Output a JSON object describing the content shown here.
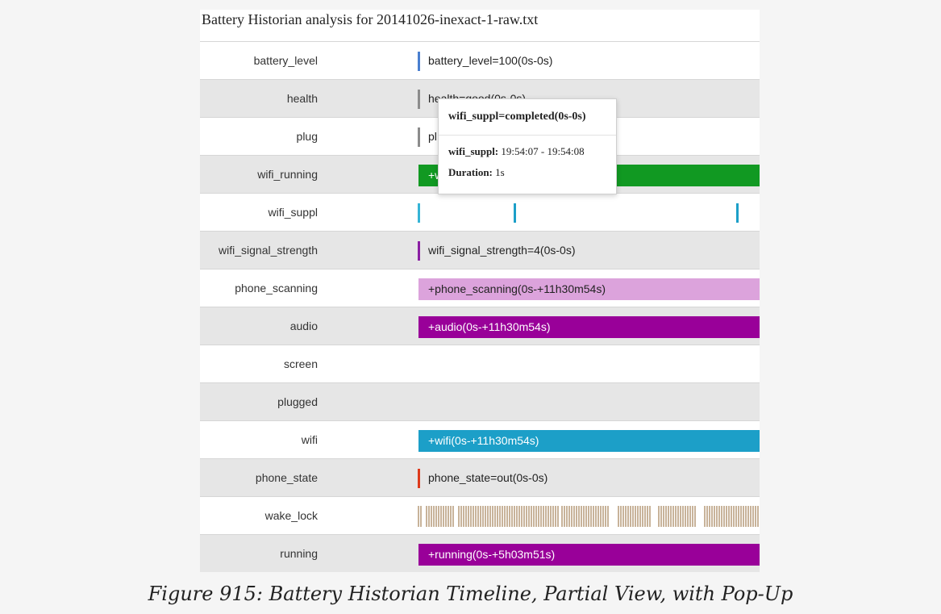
{
  "title": "Battery Historian analysis for 20141026-inexact-1-raw.txt",
  "rows": [
    {
      "label": "battery_level",
      "text": "battery_level=100(0s-0s)",
      "color": "#4a7fd0"
    },
    {
      "label": "health",
      "text": "health=good(0s-0s)",
      "color": "#8c8c8c"
    },
    {
      "label": "plug",
      "text": "pl",
      "color": "#8c8c8c"
    },
    {
      "label": "wifi_running",
      "text": "+w",
      "color": "#119922"
    },
    {
      "label": "wifi_suppl",
      "text": "",
      "color": "#36b4d6"
    },
    {
      "label": "wifi_signal_strength",
      "text": "wifi_signal_strength=4(0s-0s)",
      "color": "#8a1fa3"
    },
    {
      "label": "phone_scanning",
      "text": "+phone_scanning(0s-+11h30m54s)",
      "color": "#dca3dc"
    },
    {
      "label": "audio",
      "text": "+audio(0s-+11h30m54s)",
      "color": "#990099"
    },
    {
      "label": "screen",
      "text": ""
    },
    {
      "label": "plugged",
      "text": ""
    },
    {
      "label": "wifi",
      "text": "+wifi(0s-+11h30m54s)",
      "color": "#1c9fc8"
    },
    {
      "label": "phone_state",
      "text": "phone_state=out(0s-0s)",
      "color": "#dd3a1c"
    },
    {
      "label": "wake_lock",
      "text": "",
      "color": "#c8b39a"
    },
    {
      "label": "running",
      "text": "+running(0s-+5h03m51s)",
      "color": "#990099"
    }
  ],
  "popup": {
    "header": "wifi_suppl=completed(0s-0s)",
    "range_key": "wifi_suppl:",
    "range_value": "19:54:07 - 19:54:08",
    "duration_key": "Duration:",
    "duration_value": "1s"
  },
  "caption": "Figure 915: Battery Historian Timeline, Partial View, with Pop-Up"
}
